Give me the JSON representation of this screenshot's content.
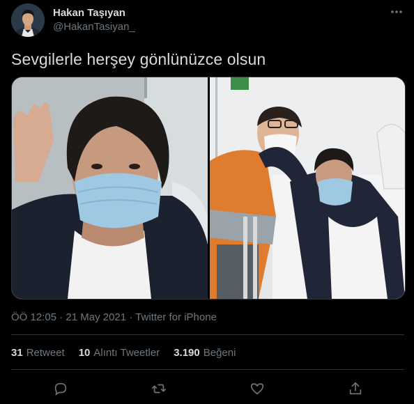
{
  "author": {
    "display_name": "Hakan Taşıyan",
    "handle": "@HakanTasiyan_"
  },
  "tweet": {
    "text": "Sevgilerle herşey gönlünüzce olsun"
  },
  "meta": {
    "time": "ÖÖ 12:05",
    "separator1": " · ",
    "date": "21 May 2021",
    "separator2": " · ",
    "source": "Twitter for iPhone"
  },
  "stats": {
    "retweets_count": "31",
    "retweets_label": "Retweet",
    "quotes_count": "10",
    "quotes_label": "Alıntı Tweetler",
    "likes_count": "3.190",
    "likes_label": "Beğeni"
  },
  "icons": {
    "more": "more-horizontal-icon",
    "reply": "reply-icon",
    "retweet": "retweet-icon",
    "like": "heart-icon",
    "share": "share-icon"
  },
  "colors": {
    "background": "#000000",
    "text_primary": "#d9d9d9",
    "text_secondary": "#6e767d",
    "divider": "#2f3336"
  }
}
